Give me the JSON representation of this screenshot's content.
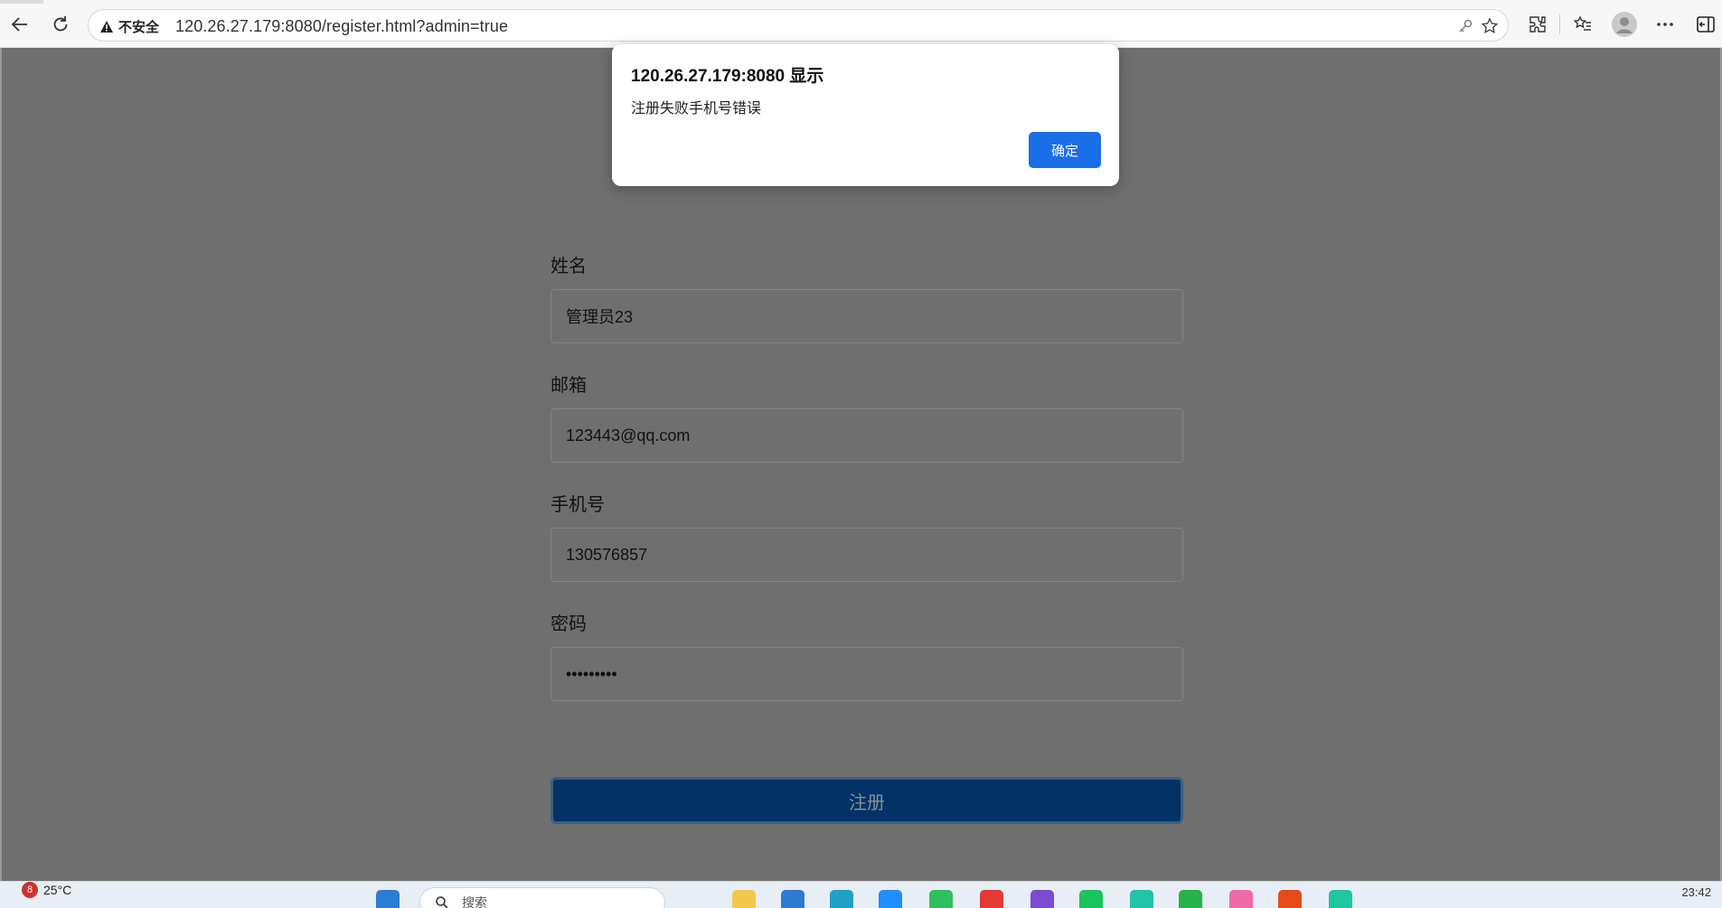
{
  "browser": {
    "security_label": "不安全",
    "url": "120.26.27.179:8080/register.html?admin=true"
  },
  "dialog": {
    "title": "120.26.27.179:8080 显示",
    "message": "注册失败手机号错误",
    "ok_label": "确定"
  },
  "form": {
    "name_label": "姓名",
    "name_value": "管理员23",
    "email_label": "邮箱",
    "email_value": "123443@qq.com",
    "phone_label": "手机号",
    "phone_value": "130576857",
    "password_label": "密码",
    "password_value": "•••••••••",
    "submit_label": "注册"
  },
  "taskbar": {
    "notification_count": "8",
    "temperature": "25°C",
    "search_placeholder": "搜索",
    "time": "23:42"
  },
  "colors": {
    "accent": "#1a6ee8",
    "submit_bg": "#023266",
    "overlay": "#6f6f6f"
  }
}
